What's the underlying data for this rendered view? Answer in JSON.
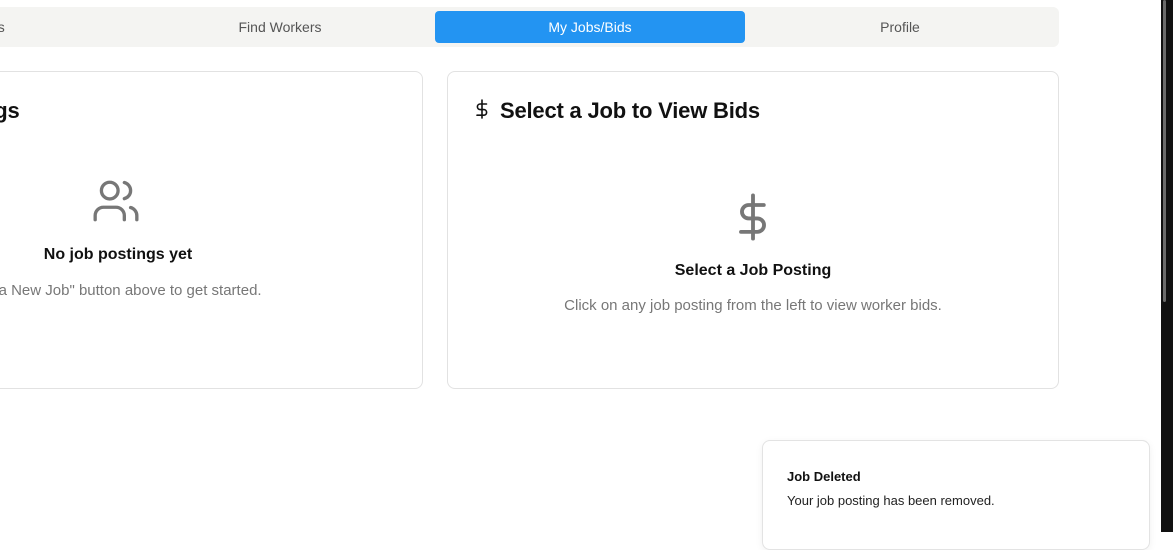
{
  "tabs": [
    {
      "label": "gs",
      "active": false
    },
    {
      "label": "Find Workers",
      "active": false
    },
    {
      "label": "My Jobs/Bids",
      "active": true
    },
    {
      "label": "Profile",
      "active": false
    }
  ],
  "postings_card": {
    "title": "ngs",
    "icon": "users-icon",
    "empty_title": "No job postings yet",
    "empty_text": "ost a New Job\" button above to get started."
  },
  "bids_card": {
    "title": "Select a Job to View Bids",
    "title_icon": "dollar-icon",
    "icon": "dollar-icon",
    "empty_title": "Select a Job Posting",
    "empty_text": "Click on any job posting from the left to view worker bids."
  },
  "toast": {
    "title": "Job Deleted",
    "message": "Your job posting has been removed."
  },
  "colors": {
    "accent": "#2394f2",
    "tab_bar": "#f4f4f2",
    "muted_text": "#777777",
    "icon": "#777777"
  }
}
